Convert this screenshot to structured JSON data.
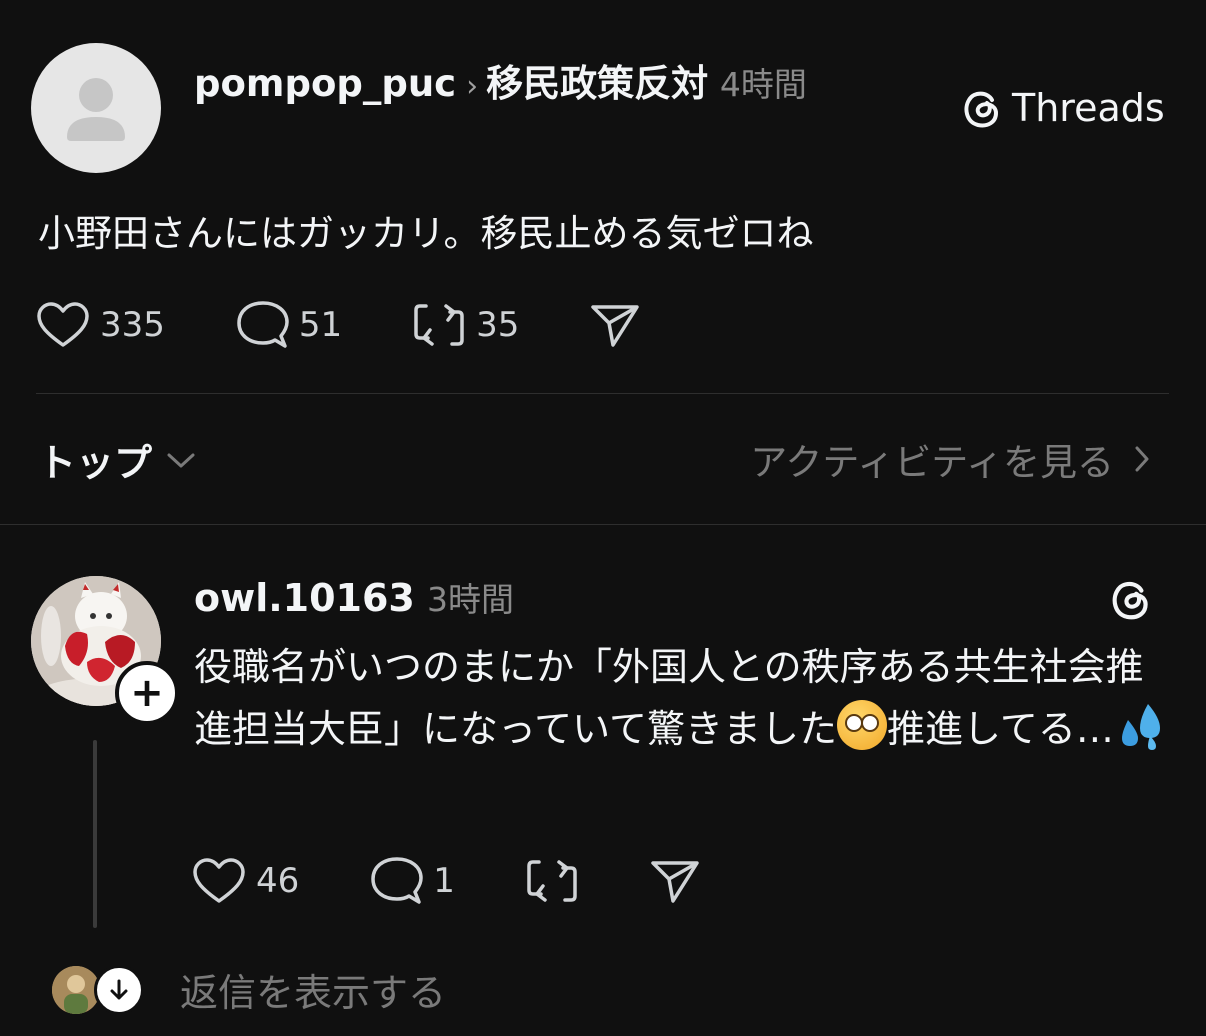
{
  "post": {
    "username": "pompop_puc",
    "topic": "移民政策反対",
    "time": "4時間",
    "brand": "Threads",
    "text": "小野田さんにはガッカリ。移民止める気ゼロね",
    "likes": "335",
    "comments": "51",
    "reposts": "35"
  },
  "sort": {
    "label": "トップ",
    "activity_link": "アクティビティを見る"
  },
  "reply": {
    "username": "owl.10163",
    "time": "3時間",
    "text_part1": "役職名がいつのまにか「外国人との秩序ある共生社会推進担当大臣」になっていて驚きました",
    "text_part2": "推進してる…",
    "likes": "46",
    "comments": "1",
    "follow_symbol": "+"
  },
  "show_replies_label": "返信を表示する",
  "icons": {
    "heart": "heart-icon",
    "comment": "comment-icon",
    "repost": "repost-icon",
    "share": "send-icon",
    "threads": "threads-logo-icon",
    "chevron_down": "chevron-down-icon",
    "chevron_right": "chevron-right-icon"
  },
  "colors": {
    "background": "#101010",
    "primary_text": "#f3f5f7",
    "secondary_text": "#7a7a7a"
  }
}
